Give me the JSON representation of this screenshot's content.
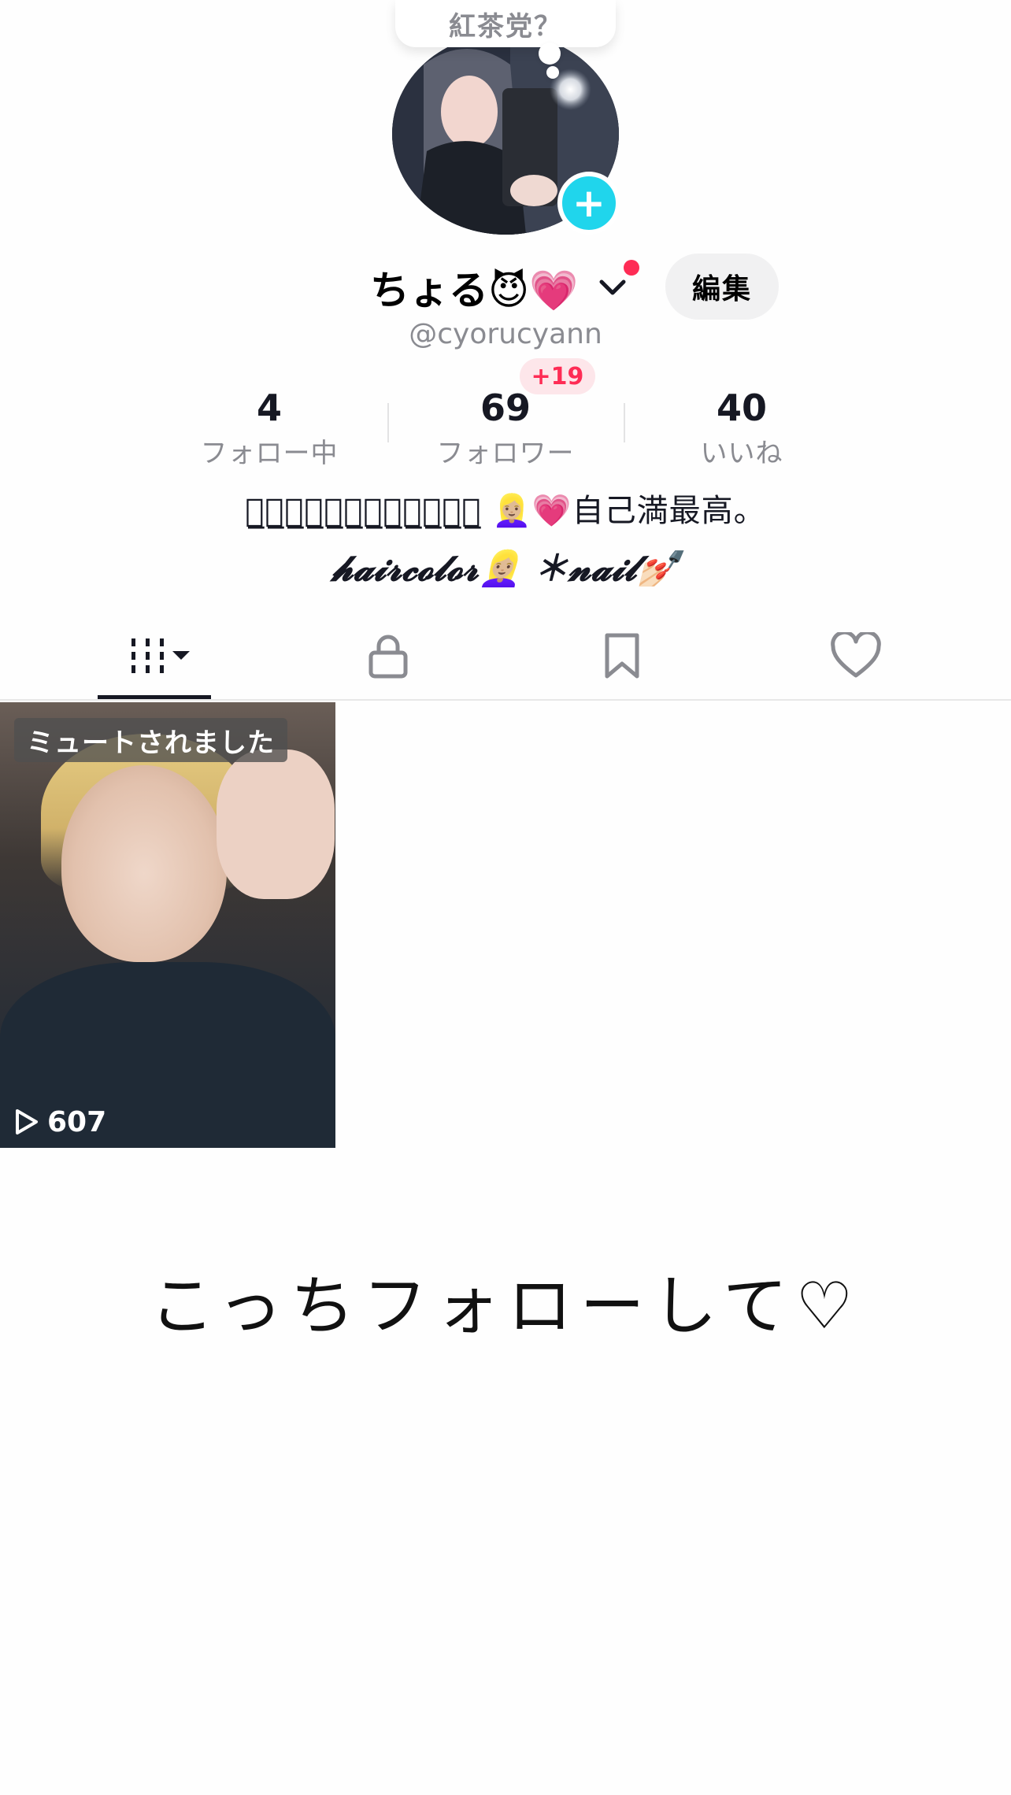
{
  "bubble": {
    "text": "紅茶党？"
  },
  "profile": {
    "display_name": "ちょる😈💗",
    "handle": "@cyorucyann",
    "edit_label": "編集"
  },
  "stats": {
    "new_followers_badge": "+19",
    "following": {
      "value": "4",
      "label": "フォロー中"
    },
    "followers": {
      "value": "69",
      "label": "フォロワー"
    },
    "likes": {
      "value": "40",
      "label": "いいね"
    }
  },
  "bio": {
    "line1": "他̲人̲ウ̲ケ̲よ̲り̲自̲分̲ウ̲ケ̲重̲視̲ 👱🏼‍♀️💗自己満最高。",
    "line2": "𝓱𝓪𝓲𝓻𝓬𝓸𝓵𝓸𝓻👱🏼‍♀️ ＊𝓷𝓪𝓲𝓵💅🏻"
  },
  "tabs": [
    {
      "icon": "grid-icon"
    },
    {
      "icon": "lock-icon"
    },
    {
      "icon": "bookmark-icon"
    },
    {
      "icon": "heart-icon"
    }
  ],
  "videos": [
    {
      "muted_label": "ミュートされました",
      "views": "607"
    }
  ],
  "caption": "こっちフォローして♡",
  "colors": {
    "accent_cyan": "#20d5ec",
    "accent_red": "#fe2c55",
    "text_gray": "#8a8b91"
  }
}
